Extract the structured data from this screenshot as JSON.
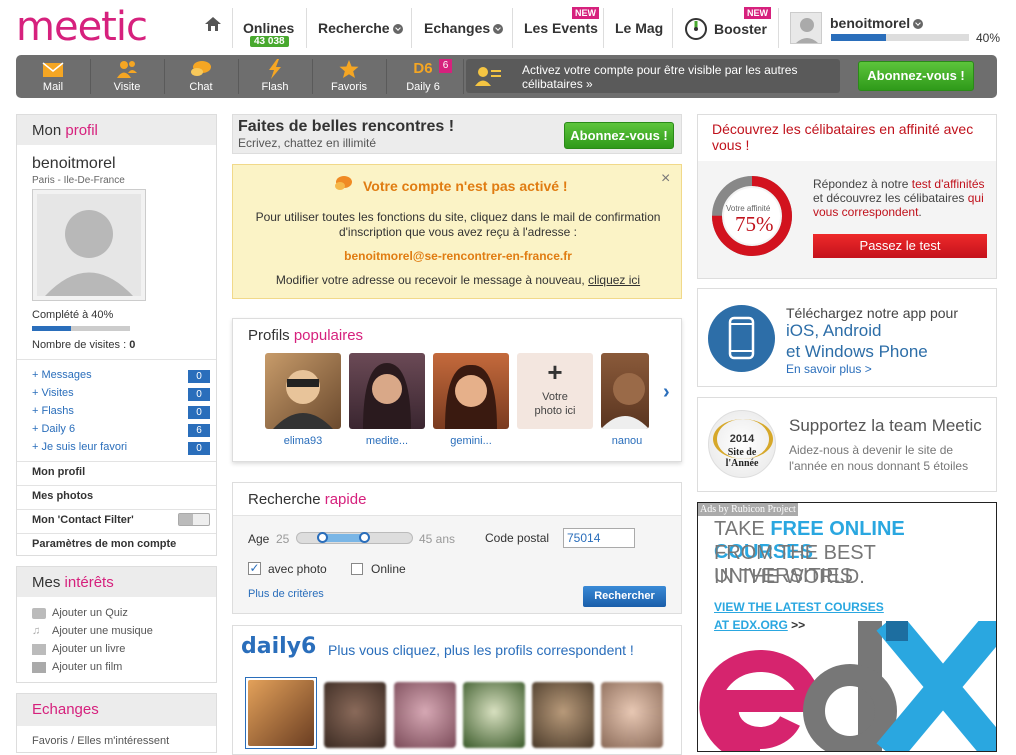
{
  "header": {
    "logo": "meetic",
    "nav": {
      "onlines_label": "Onlines",
      "onlines_count": "43 038",
      "recherche": "Recherche",
      "echanges": "Echanges",
      "events": "Les Events",
      "new_badge": "NEW",
      "mag": "Le Mag",
      "booster": "Booster",
      "booster_badge": "NEW"
    },
    "user": {
      "name": "benoitmorel",
      "progress_label": "40%",
      "progress": 0.4
    }
  },
  "toolbar": {
    "items": [
      "Mail",
      "Visite",
      "Chat",
      "Flash",
      "Favoris",
      "Daily 6"
    ],
    "daily6_badge": "6",
    "notice": "Activez votre compte pour être visible par les autres célibataires »",
    "subscribe": "Abonnez-vous !"
  },
  "profile": {
    "title_a": "Mon ",
    "title_b": "profil",
    "username": "benoitmorel",
    "location": "Paris - Ile-De-France",
    "completed": "Complété à 40%",
    "completed_value": 0.4,
    "visits_label": "Nombre de visites : ",
    "visits_count": "0",
    "links": [
      {
        "label": "+ Messages",
        "count": "0"
      },
      {
        "label": "+ Visites",
        "count": "0"
      },
      {
        "label": "+ Flashs",
        "count": "0"
      },
      {
        "label": "+ Daily 6",
        "count": "6"
      },
      {
        "label": "+ Je suis leur favori",
        "count": "0"
      }
    ],
    "menu": [
      "Mon profil",
      "Mes photos",
      "Mon 'Contact Filter'",
      "Paramètres de mon compte"
    ]
  },
  "interests": {
    "title_a": "Mes ",
    "title_b": "intérêts",
    "items": [
      "Ajouter un Quiz",
      "Ajouter une musique",
      "Ajouter un livre",
      "Ajouter un film"
    ]
  },
  "echanges": {
    "title": "Echanges",
    "first_item": "Favoris / Elles m'intéressent"
  },
  "promo": {
    "title": "Faites de belles rencontres !",
    "subtitle": "Ecrivez, chattez en illimité",
    "button": "Abonnez-vous !"
  },
  "alert": {
    "title": "Votre compte n'est pas activé !",
    "body": "Pour utiliser toutes les fonctions du site, cliquez dans le mail de confirmation d'inscription que vous avez reçu à l'adresse :",
    "email": "benoitmorel@se-rencontrer-en-france.fr",
    "footer_text": "Modifier votre adresse ou recevoir le message à nouveau, ",
    "footer_link": "cliquez ici",
    "close": "×"
  },
  "popular": {
    "title_a": "Profils ",
    "title_b": "populaires",
    "profiles": [
      "elima93",
      "medite...",
      "gemini...",
      "",
      "nanou"
    ],
    "your_photo": "Votre photo ici"
  },
  "quicksearch": {
    "title_a": "Recherche ",
    "title_b": "rapide",
    "age_label": "Age",
    "age_min": "25",
    "age_max": "45 ans",
    "postal_label": "Code postal",
    "postal_value": "75014",
    "with_photo": "avec photo",
    "online": "Online",
    "more": "Plus de critères",
    "search_button": "Rechercher"
  },
  "daily6": {
    "logo": "daily6",
    "text": "Plus vous cliquez, plus les profils correspondent !"
  },
  "affinity": {
    "title": "Découvrez les célibataires en affinité avec vous !",
    "gauge_label": "Votre affinité",
    "gauge_value": "75%",
    "gauge_fraction": 0.75,
    "text_a": "Répondez à notre ",
    "text_link": "test d'affinités",
    "text_b": " et découvrez les célibataires ",
    "text_pink": "qui vous correspondent",
    "text_c": ".",
    "button": "Passez le test"
  },
  "app": {
    "line1": "Téléchargez notre app pour",
    "line2": "iOS, Android",
    "line3": "et Windows Phone",
    "more": "En savoir plus >"
  },
  "award": {
    "year": "2014",
    "badge": "Site de l'Année",
    "title": "Supportez la team Meetic",
    "text": "Aidez-nous à devenir le site de l'année en nous donnant 5 étoiles"
  },
  "ad": {
    "label": "Ads by Rubicon Project",
    "l1a": "TAKE ",
    "l1b": "FREE ONLINE COURSES",
    "l2": "FROM THE BEST UNIVERSITIES",
    "l3": "IN THE WORLD.",
    "cta1": "VIEW THE LATEST COURSES",
    "cta2a": "AT EDX.ORG",
    "cta2b": " >>"
  }
}
